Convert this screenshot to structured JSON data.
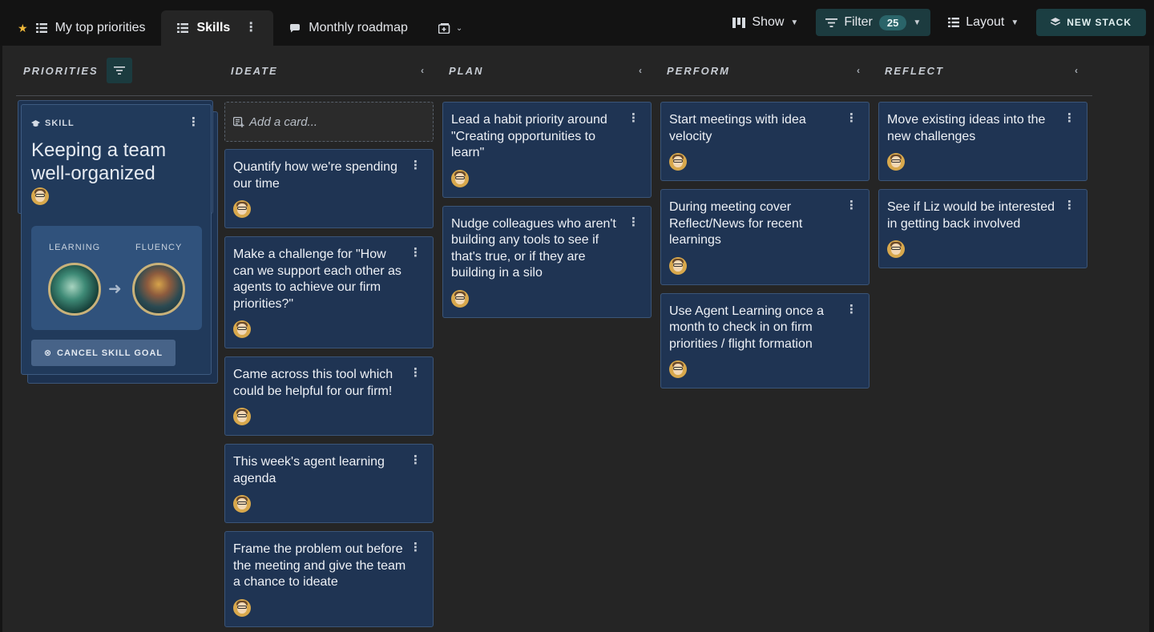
{
  "tabs": [
    {
      "label": "My top priorities",
      "icon": "list-icon",
      "starred": true
    },
    {
      "label": "Skills",
      "icon": "list-icon",
      "active": true
    },
    {
      "label": "Monthly roadmap",
      "icon": "chat-icon"
    }
  ],
  "toolbar": {
    "show_label": "Show",
    "filter_label": "Filter",
    "filter_count": "25",
    "layout_label": "Layout",
    "new_stack_label": "NEW STACK"
  },
  "columns": {
    "priorities": "PRIORITIES",
    "ideate": "IDEATE",
    "plan": "PLAN",
    "perform": "PERFORM",
    "reflect": "REFLECT"
  },
  "skill_card": {
    "label": "SKILL",
    "title": "Keeping a team well-organized",
    "from_label": "LEARNING",
    "to_label": "FLUENCY",
    "cancel_label": "CANCEL SKILL GOAL"
  },
  "add_card_placeholder": "Add a card...",
  "ideate_cards": [
    "Quantify how we're spending our time",
    "Make a challenge for \"How can we support each other as agents to achieve our firm priorities?\"",
    "Came across this tool which could be helpful for our firm!",
    "This week's agent learning agenda",
    "Frame the problem out before the meeting and give the team a chance to ideate"
  ],
  "plan_cards": [
    "Lead a habit priority around \"Creating opportunities to learn\"",
    "Nudge colleagues who aren't building any tools to see if that's true, or if they are building in a silo"
  ],
  "perform_cards": [
    "Start meetings with idea velocity",
    "During meeting cover Reflect/News for recent learnings",
    "Use Agent Learning once a month to check in on firm priorities / flight formation"
  ],
  "reflect_cards": [
    "Move existing ideas into the new challenges",
    "See if Liz would be interested in getting back involved"
  ],
  "colors": {
    "card_bg": "#1f3453",
    "accent_teal": "#1c3b3f",
    "star": "#f0b93a"
  }
}
